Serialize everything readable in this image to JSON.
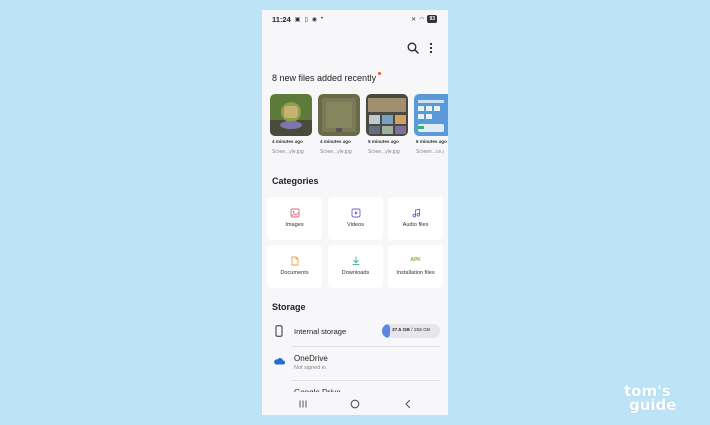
{
  "status_bar": {
    "time": "11:24",
    "battery": "93"
  },
  "recent": {
    "title": "8 new files added recently",
    "files": [
      {
        "time": "4 minutes ago",
        "name": "Scree...yle.jpg"
      },
      {
        "time": "4 minutes ago",
        "name": "Scree...yle.jpg"
      },
      {
        "time": "5 minutes ago",
        "name": "Scree...yle.jpg"
      },
      {
        "time": "6 minutes ago",
        "name": "Screen...ce.j"
      }
    ]
  },
  "categories": {
    "title": "Categories",
    "items": [
      {
        "label": "Images",
        "icon": "image-icon"
      },
      {
        "label": "Videos",
        "icon": "video-icon"
      },
      {
        "label": "Audio files",
        "icon": "music-note-icon"
      },
      {
        "label": "Documents",
        "icon": "document-icon"
      },
      {
        "label": "Downloads",
        "icon": "download-icon"
      },
      {
        "label": "Installation files",
        "icon": "apk-icon",
        "badge": "APK"
      }
    ]
  },
  "storage": {
    "title": "Storage",
    "internal": {
      "label": "Internal storage",
      "used": "37.5 GB",
      "total": " / 256 GB",
      "used_fraction": 0.146
    },
    "onedrive": {
      "label": "OneDrive",
      "status": "Not signed in"
    },
    "google_drive": {
      "label": "Google Drive"
    }
  },
  "colors": {
    "accent": "#5b86e5",
    "new_dot": "#e8572e",
    "images": "#e0607e",
    "videos": "#7a5cd6",
    "audio": "#7a5cd6",
    "documents": "#f0a43a",
    "downloads": "#3ab09e",
    "apk": "#7fb33a"
  },
  "watermark": {
    "line1": "tom's",
    "line2": "guide"
  }
}
